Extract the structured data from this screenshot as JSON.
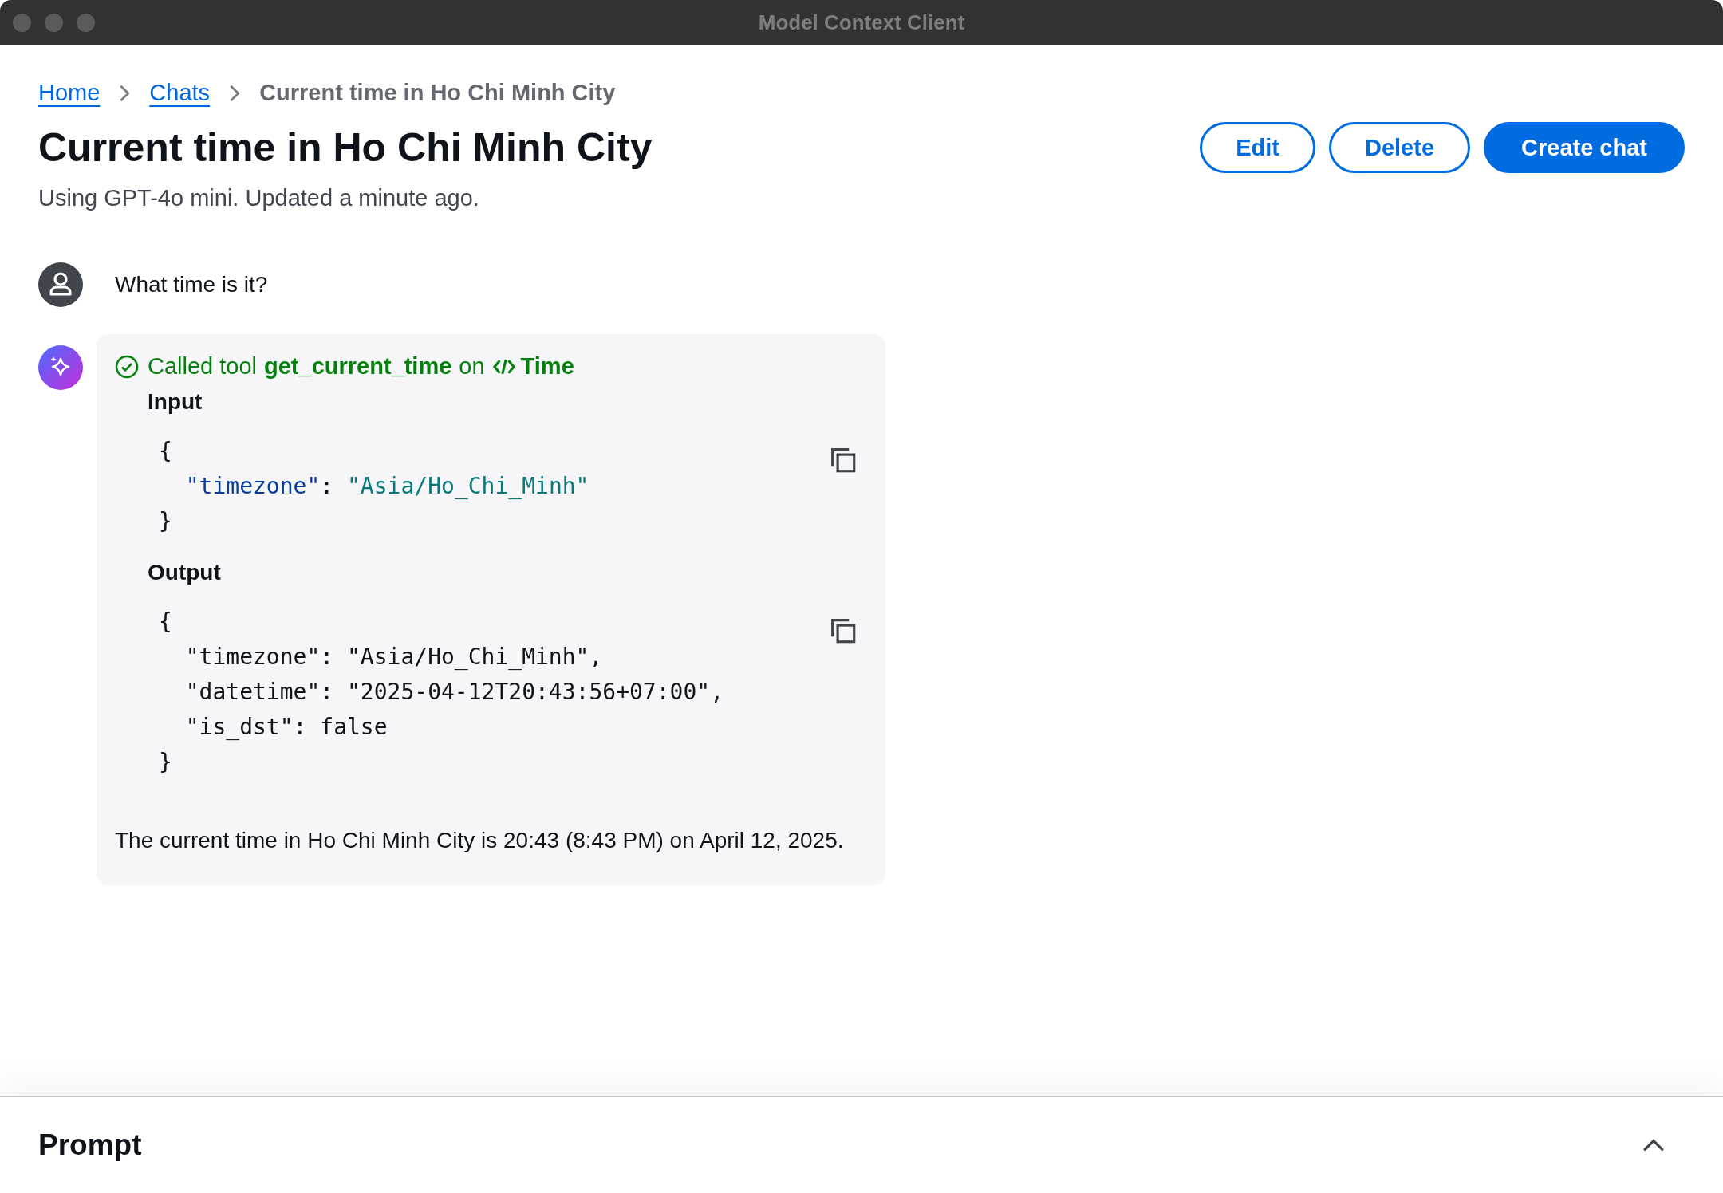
{
  "window": {
    "title": "Model Context Client"
  },
  "breadcrumbs": [
    {
      "label": "Home",
      "kind": "link"
    },
    {
      "label": "Chats",
      "kind": "link"
    },
    {
      "label": "Current time in Ho Chi Minh City",
      "kind": "current"
    }
  ],
  "page": {
    "title": "Current time in Ho Chi Minh City",
    "subtitle": "Using GPT-4o mini. Updated a minute ago."
  },
  "actions": [
    {
      "label": "Edit",
      "kind": "secondary"
    },
    {
      "label": "Delete",
      "kind": "secondary"
    },
    {
      "label": "Create chat",
      "kind": "primary"
    }
  ],
  "messages": [
    {
      "kind": "user",
      "text": "What time is it?"
    },
    {
      "kind": "assistant",
      "tool_call": {
        "succeeded": true,
        "prefix": "Called tool",
        "tool_name": "get_current_time",
        "connector": "on",
        "server_name": "Time",
        "blocks": [
          {
            "label": "Input",
            "lines": [
              [
                {
                  "text": "{",
                  "kind": "plain"
                }
              ],
              [
                {
                  "text": "  \"timezone\"",
                  "kind": "key"
                },
                {
                  "text": ": ",
                  "kind": "plain"
                },
                {
                  "text": "\"Asia/Ho_Chi_Minh\"",
                  "kind": "string"
                }
              ],
              [
                {
                  "text": "}",
                  "kind": "plain"
                }
              ]
            ]
          },
          {
            "label": "Output",
            "lines": [
              [
                {
                  "text": "{",
                  "kind": "plain"
                }
              ],
              [
                {
                  "text": "  \"timezone\": \"Asia/Ho_Chi_Minh\",",
                  "kind": "plain"
                }
              ],
              [
                {
                  "text": "  \"datetime\": \"2025-04-12T20:43:56+07:00\",",
                  "kind": "plain"
                }
              ],
              [
                {
                  "text": "  \"is_dst\": false",
                  "kind": "plain"
                }
              ],
              [
                {
                  "text": "}",
                  "kind": "plain"
                }
              ]
            ]
          }
        ]
      },
      "text": "The current time in Ho Chi Minh City is 20:43 (8:43 PM) on April 12, 2025."
    }
  ],
  "prompt_panel": {
    "title": "Prompt",
    "expanded": false
  }
}
